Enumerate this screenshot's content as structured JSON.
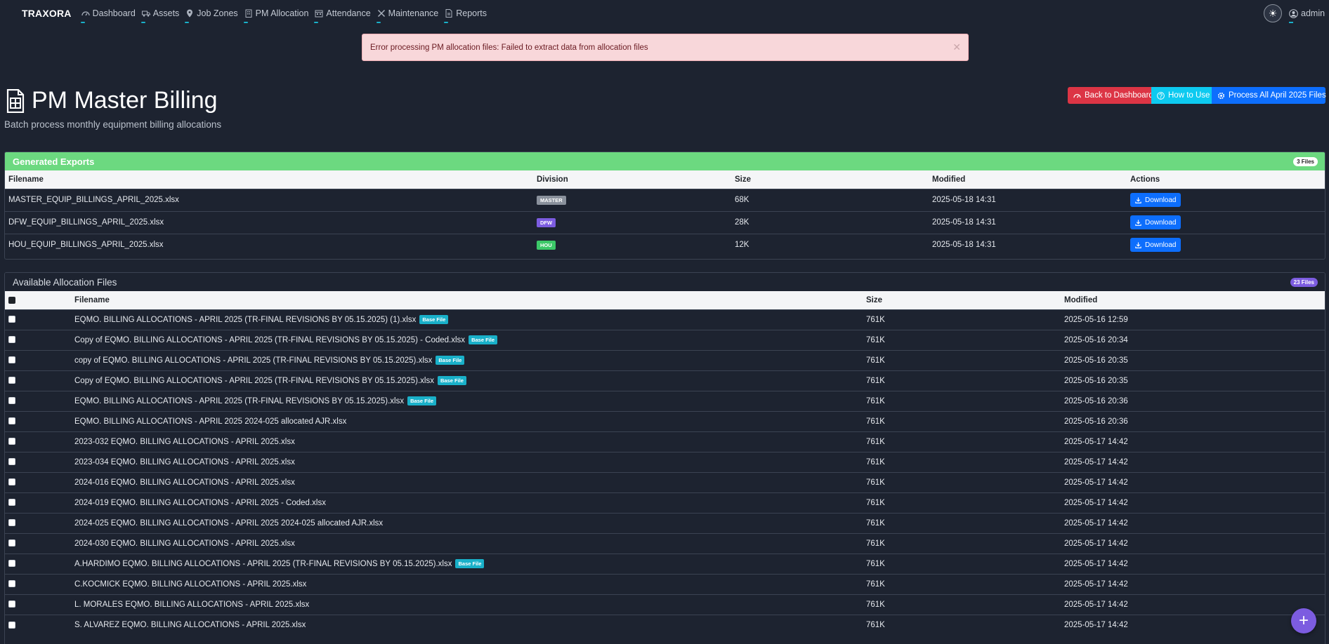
{
  "nav": {
    "brand": "TRAXORA",
    "items": [
      {
        "label": "Dashboard",
        "icon": "gauge-icon"
      },
      {
        "label": "Assets",
        "icon": "truck-icon"
      },
      {
        "label": "Job Zones",
        "icon": "map-pin-icon"
      },
      {
        "label": "PM Allocation",
        "icon": "building-icon"
      },
      {
        "label": "Attendance",
        "icon": "calendar-icon"
      },
      {
        "label": "Maintenance",
        "icon": "tools-icon"
      },
      {
        "label": "Reports",
        "icon": "report-icon"
      }
    ],
    "user": "admin"
  },
  "alert": {
    "message": "Error processing PM allocation files: Failed to extract data from allocation files"
  },
  "header": {
    "title": "PM Master Billing",
    "subtitle": "Batch process monthly equipment billing allocations",
    "buttons": {
      "back": "Back to Dashboard",
      "how": "How to Use",
      "process": "Process All April 2025 Files"
    }
  },
  "exports": {
    "title": "Generated Exports",
    "count": "3 Files",
    "columns": [
      "Filename",
      "Division",
      "Size",
      "Modified",
      "Actions"
    ],
    "rows": [
      {
        "filename": "MASTER_EQUIP_BILLINGS_APRIL_2025.xlsx",
        "division": "MASTER",
        "division_color": "#8a919c",
        "size": "68K",
        "modified": "2025-05-18 14:31",
        "action": "Download"
      },
      {
        "filename": "DFW_EQUIP_BILLINGS_APRIL_2025.xlsx",
        "division": "DFW",
        "division_color": "#7c5ce0",
        "size": "28K",
        "modified": "2025-05-18 14:31",
        "action": "Download"
      },
      {
        "filename": "HOU_EQUIP_BILLINGS_APRIL_2025.xlsx",
        "division": "HOU",
        "division_color": "#3cc868",
        "size": "12K",
        "modified": "2025-05-18 14:31",
        "action": "Download"
      }
    ]
  },
  "allocations": {
    "title": "Available Allocation Files",
    "count": "23 Files",
    "columns": [
      "Filename",
      "Size",
      "Modified"
    ],
    "base_label": "Base File",
    "rows": [
      {
        "filename": "EQMO. BILLING ALLOCATIONS - APRIL 2025 (TR-FINAL REVISIONS BY 05.15.2025) (1).xlsx",
        "base": true,
        "size": "761K",
        "modified": "2025-05-16 12:59"
      },
      {
        "filename": "Copy of EQMO. BILLING ALLOCATIONS - APRIL 2025 (TR-FINAL REVISIONS BY 05.15.2025) - Coded.xlsx",
        "base": true,
        "size": "761K",
        "modified": "2025-05-16 20:34"
      },
      {
        "filename": "copy of EQMO. BILLING ALLOCATIONS - APRIL 2025 (TR-FINAL REVISIONS BY 05.15.2025).xlsx",
        "base": true,
        "size": "761K",
        "modified": "2025-05-16 20:35"
      },
      {
        "filename": "Copy of EQMO. BILLING ALLOCATIONS - APRIL 2025 (TR-FINAL REVISIONS BY 05.15.2025).xlsx",
        "base": true,
        "size": "761K",
        "modified": "2025-05-16 20:35"
      },
      {
        "filename": "EQMO. BILLING ALLOCATIONS - APRIL 2025 (TR-FINAL REVISIONS BY 05.15.2025).xlsx",
        "base": true,
        "size": "761K",
        "modified": "2025-05-16 20:36"
      },
      {
        "filename": "EQMO. BILLING ALLOCATIONS - APRIL 2025 2024-025 allocated AJR.xlsx",
        "base": false,
        "size": "761K",
        "modified": "2025-05-16 20:36"
      },
      {
        "filename": "2023-032 EQMO. BILLING ALLOCATIONS - APRIL 2025.xlsx",
        "base": false,
        "size": "761K",
        "modified": "2025-05-17 14:42"
      },
      {
        "filename": "2023-034 EQMO. BILLING ALLOCATIONS - APRIL 2025.xlsx",
        "base": false,
        "size": "761K",
        "modified": "2025-05-17 14:42"
      },
      {
        "filename": "2024-016 EQMO. BILLING ALLOCATIONS - APRIL 2025.xlsx",
        "base": false,
        "size": "761K",
        "modified": "2025-05-17 14:42"
      },
      {
        "filename": "2024-019 EQMO. BILLING ALLOCATIONS - APRIL 2025 - Coded.xlsx",
        "base": false,
        "size": "761K",
        "modified": "2025-05-17 14:42"
      },
      {
        "filename": "2024-025 EQMO. BILLING ALLOCATIONS - APRIL 2025 2024-025 allocated AJR.xlsx",
        "base": false,
        "size": "761K",
        "modified": "2025-05-17 14:42"
      },
      {
        "filename": "2024-030 EQMO. BILLING ALLOCATIONS - APRIL 2025.xlsx",
        "base": false,
        "size": "761K",
        "modified": "2025-05-17 14:42"
      },
      {
        "filename": "A.HARDIMO EQMO. BILLING ALLOCATIONS - APRIL 2025 (TR-FINAL REVISIONS BY 05.15.2025).xlsx",
        "base": true,
        "size": "761K",
        "modified": "2025-05-17 14:42"
      },
      {
        "filename": "C.KOCMICK EQMO. BILLING ALLOCATIONS - APRIL 2025.xlsx",
        "base": false,
        "size": "761K",
        "modified": "2025-05-17 14:42"
      },
      {
        "filename": "L. MORALES EQMO. BILLING ALLOCATIONS - APRIL 2025.xlsx",
        "base": false,
        "size": "761K",
        "modified": "2025-05-17 14:42"
      },
      {
        "filename": "S. ALVAREZ EQMO. BILLING ALLOCATIONS - APRIL 2025.xlsx",
        "base": false,
        "size": "761K",
        "modified": "2025-05-17 14:42"
      }
    ]
  },
  "fab": {
    "icon": "plus-icon",
    "label": "+"
  },
  "theme_toggle": {
    "icon": "sun-icon",
    "label": "☀"
  }
}
